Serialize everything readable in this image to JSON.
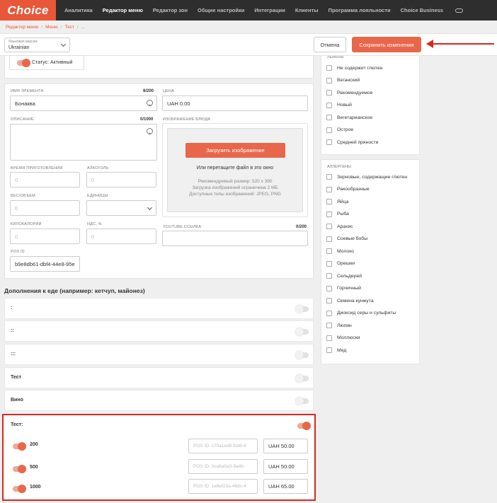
{
  "brand": {
    "logo": "Choice",
    "accent": "#e8573a"
  },
  "nav": [
    "Аналитика",
    "Редактор меню",
    "Редактор зон",
    "Общие настройки",
    "Интеграции",
    "Клиенты",
    "Программа лояльности",
    "Choice Business"
  ],
  "breadcrumbs": [
    "Редактор меню",
    "Меню",
    "Тест",
    "..."
  ],
  "lang": {
    "label": "Языковая версия:",
    "value": "Ukrainian"
  },
  "actions": {
    "cancel": "Отмена",
    "save": "Сохранить изменения"
  },
  "status": "Статус: Активный",
  "form": {
    "name": {
      "label": "ИМЯ ЭЛЕМЕНТА",
      "counter": "8/200",
      "value": "Бонаква"
    },
    "price": {
      "label": "ЦЕНА",
      "value": "UAH 0.00"
    },
    "description": {
      "label": "ОПИСАНИЕ",
      "counter": "0/1000"
    },
    "image": {
      "label": "ИЗОБРАЖЕНИЕ БЛЮДА",
      "button": "Загрузить изображение",
      "drop": "Или перетащите файл в это окно",
      "notes": [
        "Рекомендуемый размер: 520 x 390",
        "Загрузка изображений ограничена 2 МБ",
        "Доступные типы изображений: JPEG, PNG"
      ]
    },
    "cook_time": {
      "label": "ВРЕМЯ ПРИГОТОВЛЕНИЯ",
      "placeholder": "0"
    },
    "alcohol": {
      "label": "АЛКОГОЛЬ",
      "placeholder": "0"
    },
    "weight": {
      "label": "ВЕС/ОБЪЕМ",
      "placeholder": "0"
    },
    "units": {
      "label": "ЕДИНИЦЫ"
    },
    "kcal": {
      "label": "КИЛОКАЛОРИИ",
      "placeholder": "0"
    },
    "vat": {
      "label": "НДС, %",
      "placeholder": "0"
    },
    "youtube": {
      "label": "YOUTUBE ССЫЛКА",
      "counter": "0/200"
    },
    "pos": {
      "label": "POS ID",
      "value": "b9e8db61-dbf4-44e8-95e"
    }
  },
  "addons": {
    "title": "Дополнения к еде (например: кетчуп, майонез)",
    "groups": [
      ":",
      "::",
      ":::",
      "Тест",
      "Вино"
    ],
    "active_group": {
      "name": "Тест:",
      "variants": [
        {
          "name": "200",
          "pos": "POS ID: c70a1ed8-fcb8-4",
          "price": "UAH 50.00"
        },
        {
          "name": "500",
          "pos": "POS ID: 3ca6a0a3-9a4b-",
          "price": "UAH 50.00"
        },
        {
          "name": "1000",
          "pos": "POS ID: 1e8ef23a-48dc-4",
          "price": "UAH 65.00"
        }
      ]
    }
  },
  "labels": {
    "title": "ЛЕЙБЛЫ",
    "items": [
      "Не содержит глютен",
      "Веганский",
      "Рекомендуемое",
      "Новый",
      "Вегетарианское",
      "Острое",
      "Средней пряности"
    ]
  },
  "allergens": {
    "title": "АЛЛЕРГЕНЫ",
    "items": [
      "Зерновые, содержащие глютен",
      "Ракообразные",
      "Яйца",
      "Рыба",
      "Арахис",
      "Соевые бобы",
      "Молоко",
      "Орешки",
      "Сельдерей",
      "Горчичный",
      "Семена кунжута",
      "Диоксид серы и сульфиты",
      "Люпин",
      "Моллюски",
      "Мед"
    ]
  }
}
